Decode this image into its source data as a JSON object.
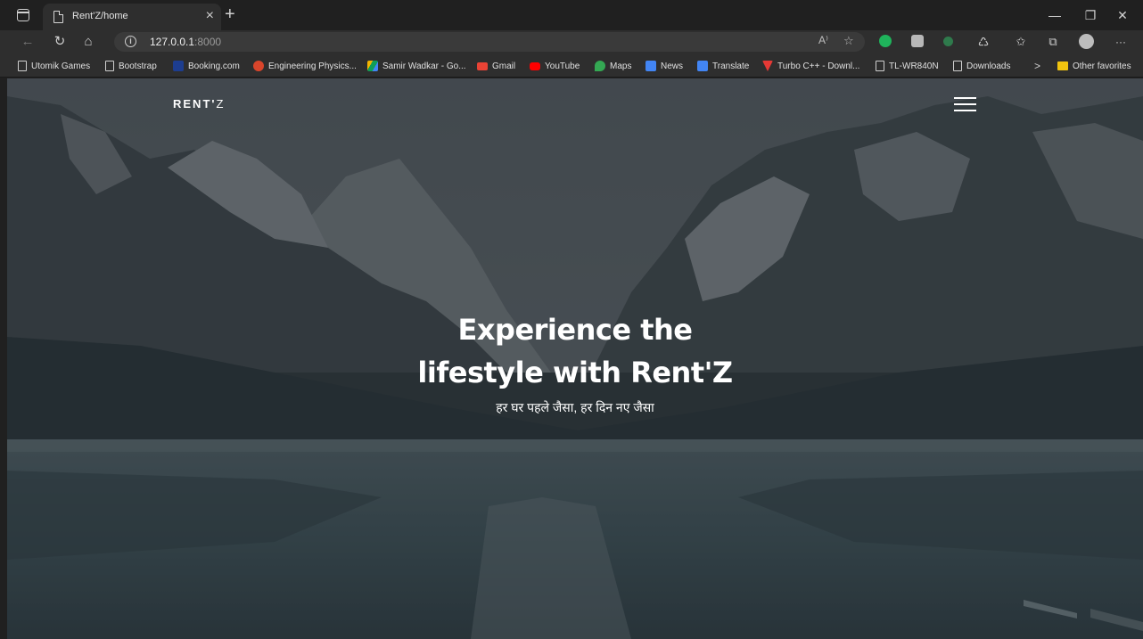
{
  "browser": {
    "tab_title": "Rent'Z/home",
    "tab_close": "×",
    "new_tab": "+",
    "url_host": "127.0.0.1",
    "url_port": ":8000",
    "read_aloud": "A⁾",
    "window_controls": {
      "minimize": "—",
      "restore": "❐",
      "close": "✕"
    },
    "more": "···"
  },
  "bookmarks": [
    {
      "label": "Utomik Games",
      "icon": "page-icon"
    },
    {
      "label": "Bootstrap",
      "icon": "page-icon"
    },
    {
      "label": "Booking.com",
      "icon": "booking-icon"
    },
    {
      "label": "Engineering Physics...",
      "icon": "pdf-icon"
    },
    {
      "label": "Samir Wadkar - Go...",
      "icon": "drive-icon"
    },
    {
      "label": "Gmail",
      "icon": "gmail-icon"
    },
    {
      "label": "YouTube",
      "icon": "youtube-icon"
    },
    {
      "label": "Maps",
      "icon": "maps-icon"
    },
    {
      "label": "News",
      "icon": "news-icon"
    },
    {
      "label": "Translate",
      "icon": "translate-icon"
    },
    {
      "label": "Turbo C++ - Downl...",
      "icon": "turbo-icon"
    },
    {
      "label": "TL-WR840N",
      "icon": "page-icon"
    },
    {
      "label": "Downloads",
      "icon": "page-icon"
    },
    {
      "label": "Other favorites",
      "icon": "folder-icon"
    }
  ],
  "bookmarks_overflow": ">",
  "site": {
    "logo_main": "RENT'",
    "logo_thin": "Z",
    "hero_line1": "Experience the",
    "hero_line2": "lifestyle with Rent'Z",
    "tagline": "हर घर पहले जैसा, हर दिन नए जैसा"
  },
  "colors": {
    "browser_dark": "#202020",
    "toolbar": "#2e2e2e",
    "hero_text": "#ffffff",
    "youtube": "#ff0000",
    "gmail": "#ea4335"
  }
}
